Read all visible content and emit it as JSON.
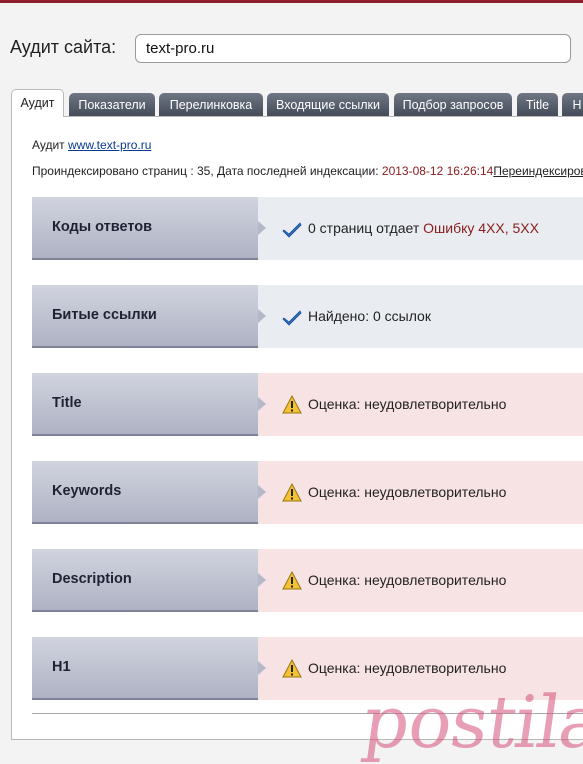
{
  "header": {
    "label": "Аудит сайта:",
    "site_value": "text-pro.ru"
  },
  "tabs": [
    {
      "label": "Аудит",
      "active": true
    },
    {
      "label": "Показатели"
    },
    {
      "label": "Перелинковка"
    },
    {
      "label": "Входящие ссылки"
    },
    {
      "label": "Подбор запросов"
    },
    {
      "label": "Title"
    },
    {
      "label": "Н"
    }
  ],
  "audit": {
    "prefix": "Аудит",
    "link_text": "www.text-pro.ru",
    "index_text": "Проиндексировано страниц : 35, Дата последней индексации:",
    "index_date": "2013-08-12 16:26:14",
    "reindex_link": "Переиндексировать"
  },
  "rows": [
    {
      "label": "Коды ответов",
      "status": "ok",
      "text_main": "0 страниц отдает",
      "text_extra": "Ошибку 4XX, 5XX"
    },
    {
      "label": "Битые ссылки",
      "status": "ok",
      "text_main": "Найдено: 0 ссылок"
    },
    {
      "label": "Title",
      "status": "warn",
      "text_main": "Оценка: неудовлетворительно"
    },
    {
      "label": "Keywords",
      "status": "warn",
      "text_main": "Оценка: неудовлетворительно"
    },
    {
      "label": "Description",
      "status": "warn",
      "text_main": "Оценка: неудовлетворительно"
    },
    {
      "label": "H1",
      "status": "warn",
      "text_main": "Оценка: неудовлетворительно"
    }
  ],
  "watermark": "postila.ru",
  "colors": {
    "accent": "#8b1f2c",
    "link": "#0b3a8f",
    "error": "#8a1d1d",
    "ok_bg": "#e9edf1",
    "warn_bg": "#f7e3e3"
  },
  "icons": {
    "ok": "check-icon",
    "warn": "warning-icon"
  }
}
